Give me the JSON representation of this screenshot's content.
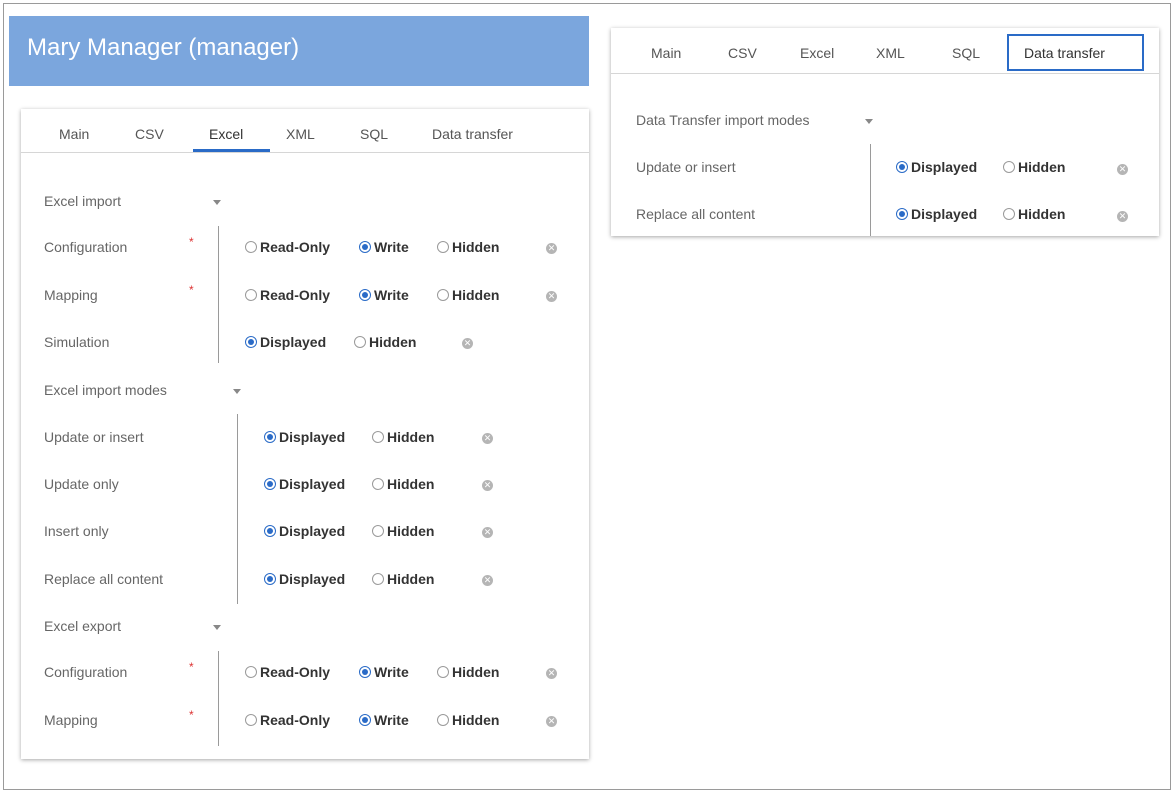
{
  "header": {
    "title": "Mary Manager (manager)"
  },
  "left": {
    "tabs": [
      "Main",
      "CSV",
      "Excel",
      "XML",
      "SQL",
      "Data transfer"
    ],
    "active_tab": "Excel",
    "import_section": "Excel import",
    "rows": [
      {
        "label": "Configuration",
        "options": [
          "Read-Only",
          "Write",
          "Hidden"
        ],
        "selected": "Write",
        "required": true
      },
      {
        "label": "Mapping",
        "options": [
          "Read-Only",
          "Write",
          "Hidden"
        ],
        "selected": "Write",
        "required": true
      },
      {
        "label": "Simulation",
        "options": [
          "Displayed",
          "Hidden"
        ],
        "selected": "Displayed"
      }
    ],
    "modes_section": "Excel import modes",
    "modes": [
      {
        "label": "Update or insert",
        "options": [
          "Displayed",
          "Hidden"
        ],
        "selected": "Displayed"
      },
      {
        "label": "Update only",
        "options": [
          "Displayed",
          "Hidden"
        ],
        "selected": "Displayed"
      },
      {
        "label": "Insert only",
        "options": [
          "Displayed",
          "Hidden"
        ],
        "selected": "Displayed"
      },
      {
        "label": "Replace all content",
        "options": [
          "Displayed",
          "Hidden"
        ],
        "selected": "Displayed"
      }
    ],
    "export_section": "Excel export",
    "export_rows": [
      {
        "label": "Configuration",
        "options": [
          "Read-Only",
          "Write",
          "Hidden"
        ],
        "selected": "Write",
        "required": true
      },
      {
        "label": "Mapping",
        "options": [
          "Read-Only",
          "Write",
          "Hidden"
        ],
        "selected": "Write",
        "required": true
      }
    ]
  },
  "right": {
    "tabs": [
      "Main",
      "CSV",
      "Excel",
      "XML",
      "SQL",
      "Data transfer"
    ],
    "active_tab": "Data transfer",
    "section": "Data Transfer import modes",
    "rows": [
      {
        "label": "Update or insert",
        "options": [
          "Displayed",
          "Hidden"
        ],
        "selected": "Displayed"
      },
      {
        "label": "Replace all content",
        "options": [
          "Displayed",
          "Hidden"
        ],
        "selected": "Displayed"
      }
    ]
  },
  "colors": {
    "header_bg": "#7ba6dd",
    "accent": "#2a6bc7",
    "required": "#dd3333"
  },
  "icons": {
    "clear": "clear-circle-icon",
    "caret": "caret-down-icon",
    "required": "required-asterisk-icon"
  }
}
